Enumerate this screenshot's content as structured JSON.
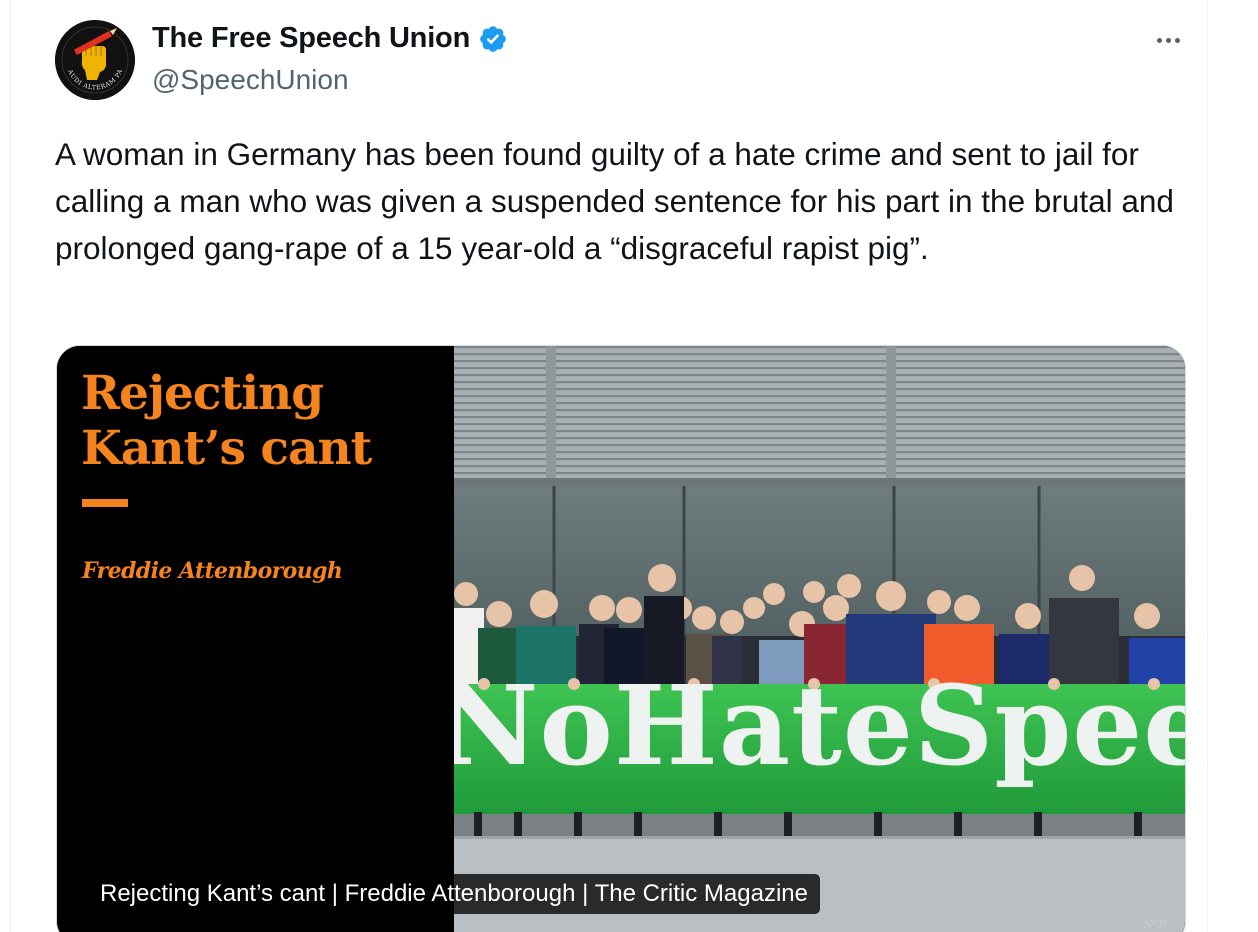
{
  "tweet": {
    "author": {
      "display_name": "The Free Speech Union",
      "handle": "@SpeechUnion",
      "verified_icon": "verified-badge-icon",
      "avatar_icon": "raised-fist-pencil-icon",
      "avatar_motto": "AUDI ALTERAM PARTEM"
    },
    "more_icon": "more-options-icon",
    "text": "A woman in Germany has been found guilty of a hate crime and sent to jail for calling a man who was given a suspended sentence for his part in the brutal and prolonged gang-rape of a 15 year-old a “disgraceful rapist pig”.",
    "card": {
      "title_line1": "Rejecting",
      "title_line2": "Kant’s cant",
      "author": "Freddie Attenborough",
      "banner_text": "NoHateSpee",
      "photo_credit": "S*B",
      "caption": "Rejecting Kant’s cant | Freddie Attenborough | The Critic Magazine"
    }
  },
  "colors": {
    "accent_orange": "#f5841f",
    "banner_green": "#2fb84a",
    "verified_blue": "#1d9bf0",
    "text_primary": "#0f1419",
    "text_secondary": "#536471"
  }
}
